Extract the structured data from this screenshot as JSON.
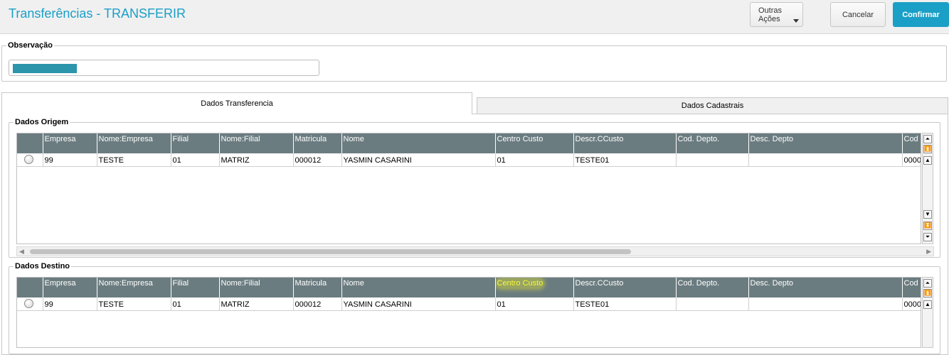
{
  "page": {
    "title": "Transferências - TRANSFERIR"
  },
  "toolbar": {
    "more_label": "Outras Ações",
    "cancel_label": "Cancelar",
    "confirm_label": "Confirmar"
  },
  "observacao": {
    "legend": "Observação",
    "value": ""
  },
  "tabs": [
    {
      "label": "Dados Transferencia"
    },
    {
      "label": "Dados Cadastrais"
    }
  ],
  "origem": {
    "legend": "Dados Origem",
    "columns": [
      "",
      "Empresa",
      "Nome:Empresa",
      "Filial",
      "Nome:Filial",
      "Matricula",
      "Nome",
      "Centro Custo",
      "Descr.CCusto",
      "Cod. Depto.",
      "Desc. Depto",
      "Cod F"
    ],
    "rows": [
      [
        "",
        "99",
        "TESTE",
        "01",
        "MATRIZ",
        "000012",
        "YASMIN CASARINI",
        "01",
        "TESTE01",
        "",
        "",
        "0000"
      ]
    ]
  },
  "destino": {
    "legend": "Dados Destino",
    "columns": [
      "",
      "Empresa",
      "Nome:Empresa",
      "Filial",
      "Nome:Filial",
      "Matricula",
      "Nome",
      "Centro Custo",
      "Descr.CCusto",
      "Cod. Depto.",
      "Desc. Depto",
      "Cod F"
    ],
    "rows": [
      [
        "",
        "99",
        "TESTE",
        "01",
        "MATRIZ",
        "000012",
        "YASMIN CASARINI",
        "01",
        "TESTE01",
        "",
        "",
        "0000"
      ]
    ]
  },
  "colors": {
    "accent": "#1a9fc7",
    "grid_header": "#6b7c80",
    "highlight": "#f6f93a"
  },
  "icons": {
    "scroll_top": "double-up-arrow-icon",
    "scroll_up": "up-arrow-icon",
    "scroll_down": "down-arrow-icon",
    "scroll_bottom": "double-down-arrow-icon"
  }
}
